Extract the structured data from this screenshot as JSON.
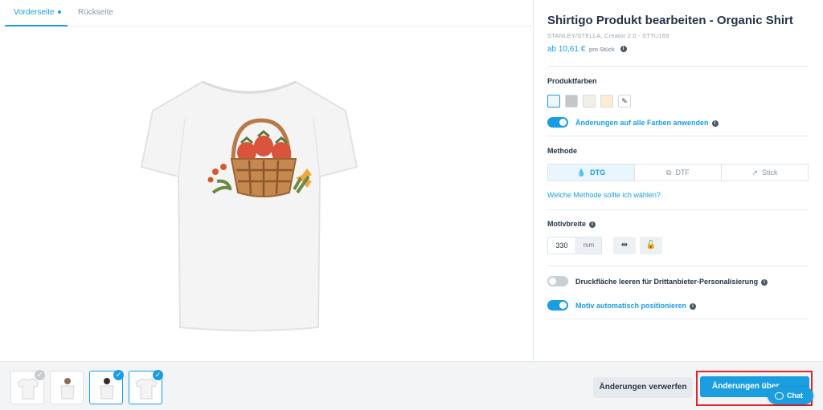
{
  "tabs": [
    {
      "label": "Vorderseite",
      "active": true
    },
    {
      "label": "Rückseite",
      "active": false
    }
  ],
  "product": {
    "title": "Shirtigo Produkt bearbeiten - Organic Shirt",
    "subtitle": "STANLEY/STELLA, Creator 2.0 - STTU169",
    "price": "ab 10,61 €",
    "price_unit": "pro Stück"
  },
  "colors": {
    "label": "Produktfarben",
    "swatches": [
      "#eef6fb",
      "#c4c6c8",
      "#f2efe9",
      "#fcecd4"
    ],
    "apply_all_label": "Änderungen auf alle Farben anwenden",
    "apply_all_on": true
  },
  "method": {
    "label": "Methode",
    "options": [
      {
        "label": "DTG",
        "icon": "drop-icon",
        "active": true
      },
      {
        "label": "DTF",
        "icon": "transfer-icon",
        "active": false
      },
      {
        "label": "Stick",
        "icon": "needle-icon",
        "active": false
      }
    ],
    "help_link": "Welche Methode sollte ich wählen?"
  },
  "motif": {
    "label": "Motivbreite",
    "width_value": "330",
    "width_unit": "mm"
  },
  "toggles": {
    "clear_print_label": "Druckfläche leeren für Drittanbieter-Personalisierung",
    "clear_print_on": false,
    "auto_position_label": "Motiv automatisch positionieren",
    "auto_position_on": true
  },
  "footer": {
    "discard_label": "Änderungen verwerfen",
    "apply_label": "Änderungen über",
    "chat_label": "Chat"
  },
  "thumbnails": [
    {
      "view": "flat-front",
      "checked": false
    },
    {
      "view": "model-male",
      "checked": false
    },
    {
      "view": "model-female",
      "checked": true
    },
    {
      "view": "flat-detail",
      "checked": true
    }
  ],
  "colors_accent": {
    "primary": "#1a9ee0",
    "highlight": "#e0262b"
  }
}
